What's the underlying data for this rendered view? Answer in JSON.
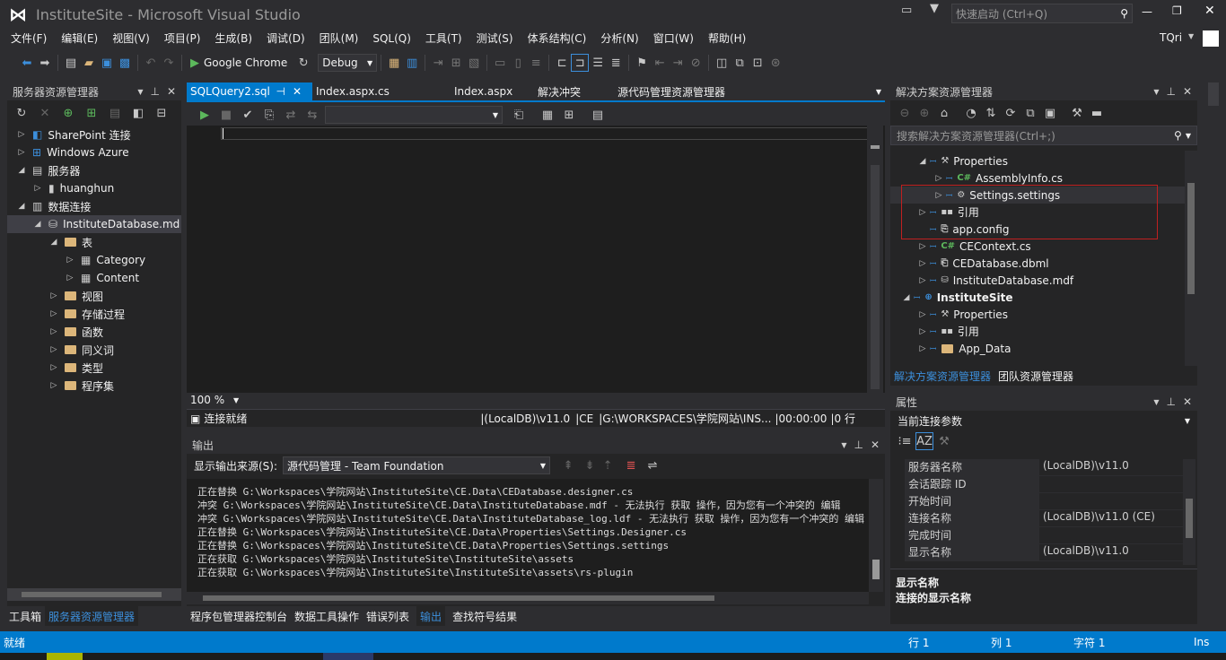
{
  "app": {
    "title": "InstituteSite - Microsoft Visual Studio",
    "quick_launch": "快速启动 (Ctrl+Q)",
    "user": "TQri"
  },
  "menu": [
    "文件(F)",
    "编辑(E)",
    "视图(V)",
    "项目(P)",
    "生成(B)",
    "调试(D)",
    "团队(M)",
    "SQL(Q)",
    "工具(T)",
    "测试(S)",
    "体系结构(C)",
    "分析(N)",
    "窗口(W)",
    "帮助(H)"
  ],
  "toolbar": {
    "browser": "Google Chrome",
    "config": "Debug"
  },
  "server_explorer": {
    "title": "服务器资源管理器",
    "items": [
      {
        "label": "SharePoint 连接",
        "indent": 0,
        "arrow": "▷"
      },
      {
        "label": "Windows Azure",
        "indent": 0,
        "arrow": "▷"
      },
      {
        "label": "服务器",
        "indent": 0,
        "arrow": "◢"
      },
      {
        "label": "huanghun",
        "indent": 1,
        "arrow": "▷"
      },
      {
        "label": "数据连接",
        "indent": 0,
        "arrow": "◢"
      },
      {
        "label": "InstituteDatabase.md",
        "indent": 1,
        "arrow": "◢"
      },
      {
        "label": "表",
        "indent": 2,
        "arrow": "◢"
      },
      {
        "label": "Category",
        "indent": 3,
        "arrow": "▷"
      },
      {
        "label": "Content",
        "indent": 3,
        "arrow": "▷"
      },
      {
        "label": "视图",
        "indent": 2,
        "arrow": "▷"
      },
      {
        "label": "存储过程",
        "indent": 2,
        "arrow": "▷"
      },
      {
        "label": "函数",
        "indent": 2,
        "arrow": "▷"
      },
      {
        "label": "同义词",
        "indent": 2,
        "arrow": "▷"
      },
      {
        "label": "类型",
        "indent": 2,
        "arrow": "▷"
      },
      {
        "label": "程序集",
        "indent": 2,
        "arrow": "▷"
      }
    ],
    "bottom_tabs": [
      "工具箱",
      "服务器资源管理器"
    ]
  },
  "editor": {
    "tabs": [
      "SQLQuery2.sql",
      "Index.aspx.cs",
      "Index.aspx",
      "解决冲突",
      "源代码管理资源管理器"
    ],
    "zoom": "100 %",
    "status": "连接就绪",
    "conn": "(LocalDB)\\v11.0",
    "ce": "CE",
    "path": "G:\\WORKSPACES\\学院网站\\INS...",
    "time": "00:00:00",
    "rows": "0 行"
  },
  "output": {
    "title": "输出",
    "source_label": "显示输出来源(S):",
    "source": "源代码管理 - Team Foundation",
    "lines": [
      "正在替换 G:\\Workspaces\\学院网站\\InstituteSite\\CE.Data\\CEDatabase.designer.cs",
      "冲突 G:\\Workspaces\\学院网站\\InstituteSite\\CE.Data\\InstituteDatabase.mdf - 无法执行 获取 操作，因为您有一个冲突的 编辑",
      "冲突 G:\\Workspaces\\学院网站\\InstituteSite\\CE.Data\\InstituteDatabase_log.ldf - 无法执行 获取 操作，因为您有一个冲突的 编辑",
      "正在替换 G:\\Workspaces\\学院网站\\InstituteSite\\CE.Data\\Properties\\Settings.Designer.cs",
      "正在替换 G:\\Workspaces\\学院网站\\InstituteSite\\CE.Data\\Properties\\Settings.settings",
      "正在获取 G:\\Workspaces\\学院网站\\InstituteSite\\InstituteSite\\assets",
      "正在获取 G:\\Workspaces\\学院网站\\InstituteSite\\InstituteSite\\assets\\rs-plugin"
    ],
    "bottom_tabs": [
      "程序包管理器控制台",
      "数据工具操作",
      "错误列表",
      "输出",
      "查找符号结果"
    ]
  },
  "solution": {
    "title": "解决方案资源管理器",
    "search": "搜索解决方案资源管理器(Ctrl+;)",
    "items": [
      {
        "label": "Properties",
        "indent": 1,
        "arrow": "◢",
        "icon": "wrench"
      },
      {
        "label": "AssemblyInfo.cs",
        "indent": 2,
        "arrow": "▷",
        "icon": "C#"
      },
      {
        "label": "Settings.settings",
        "indent": 2,
        "arrow": "▷",
        "icon": "gear"
      },
      {
        "label": "引用",
        "indent": 1,
        "arrow": "▷",
        "icon": "ref"
      },
      {
        "label": "app.config",
        "indent": 1,
        "arrow": "",
        "icon": "config"
      },
      {
        "label": "CEContext.cs",
        "indent": 1,
        "arrow": "▷",
        "icon": "C#"
      },
      {
        "label": "CEDatabase.dbml",
        "indent": 1,
        "arrow": "▷",
        "icon": "dbml"
      },
      {
        "label": "InstituteDatabase.mdf",
        "indent": 1,
        "arrow": "▷",
        "icon": "db"
      },
      {
        "label": "InstituteSite",
        "indent": 0,
        "arrow": "◢",
        "icon": "web",
        "bold": true
      },
      {
        "label": "Properties",
        "indent": 1,
        "arrow": "▷",
        "icon": "wrench"
      },
      {
        "label": "引用",
        "indent": 1,
        "arrow": "▷",
        "icon": "ref"
      },
      {
        "label": "App_Data",
        "indent": 1,
        "arrow": "▷",
        "icon": "folder"
      }
    ],
    "bottom_tabs": [
      "解决方案资源管理器",
      "团队资源管理器"
    ]
  },
  "properties": {
    "title": "属性",
    "object": "当前连接参数",
    "rows": [
      {
        "name": "服务器名称",
        "value": "(LocalDB)\\v11.0"
      },
      {
        "name": "会话跟踪 ID",
        "value": ""
      },
      {
        "name": "开始时间",
        "value": ""
      },
      {
        "name": "连接名称",
        "value": "(LocalDB)\\v11.0  (CE)"
      },
      {
        "name": "完成时间",
        "value": ""
      },
      {
        "name": "显示名称",
        "value": "(LocalDB)\\v11.0"
      }
    ],
    "desc_title": "显示名称",
    "desc_text": "连接的显示名称"
  },
  "status": {
    "left": "就绪",
    "line": "行 1",
    "col": "列 1",
    "char": "字符 1",
    "mode": "Ins"
  }
}
